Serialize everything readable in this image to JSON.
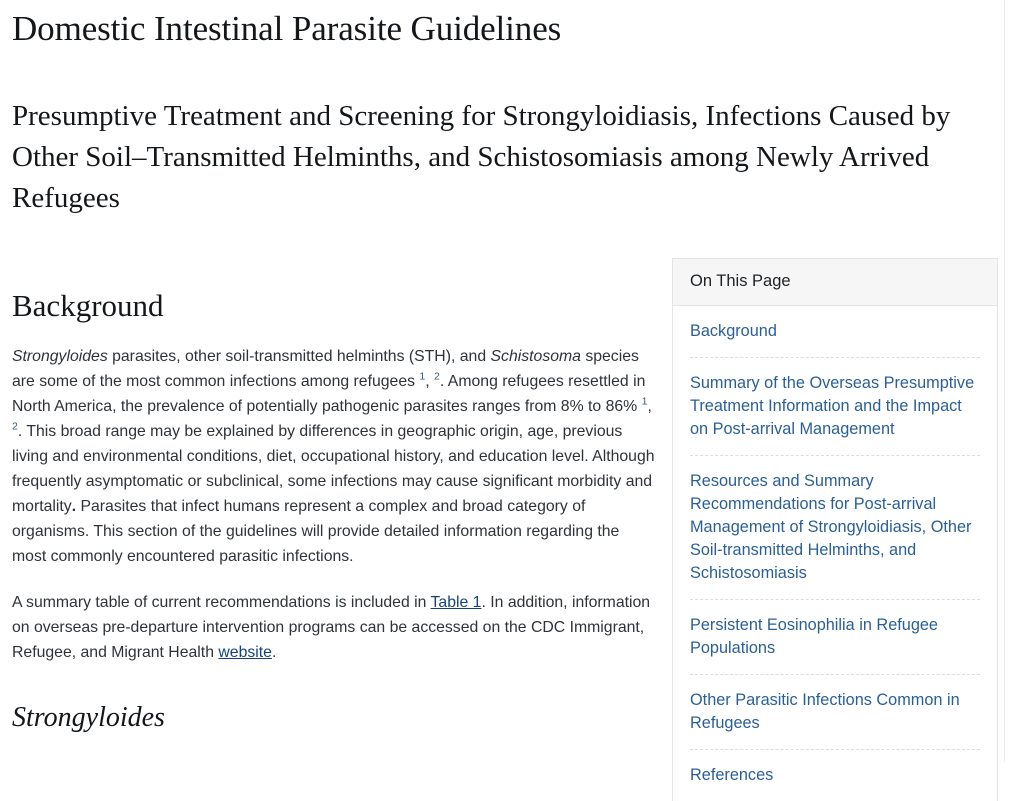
{
  "document": {
    "title": "Domestic Intestinal Parasite Guidelines",
    "subtitle": "Presumptive Treatment and Screening for Strongyloidiasis, Infections Caused by Other Soil–Transmitted Helminths, and Schistosomiasis among Newly Arrived Refugees"
  },
  "main": {
    "background_heading": "Background",
    "paragraph1": {
      "seg1_italic": "Strongyloides",
      "seg2": " parasites, other soil-transmitted helminths (STH), and ",
      "seg3_italic": "Schistosoma",
      "seg4": " species are some of the most common infections among refugees ",
      "ref1": "1",
      "seg5": ", ",
      "ref2": "2",
      "seg6": ". Among refugees resettled in North America, the prevalence of potentially pathogenic parasites ranges from 8% to 86% ",
      "ref3": "1",
      "seg7": ", ",
      "ref4": "2",
      "seg8": ". This broad range may be explained by differences in geographic origin, age, previous living and environmental conditions, diet, occupational history, and education level. Although frequently asymptomatic or subclinical, some infections may cause significant morbidity and mortality",
      "bold_period": ".",
      "seg9": " Parasites that infect humans represent a complex and broad category of organisms. This section of the guidelines will provide detailed information regarding the most commonly encountered parasitic infections."
    },
    "paragraph2": {
      "seg1": "A summary table of current recommendations is included in ",
      "link_table": "Table 1",
      "seg2": ".  In addition, information on overseas pre-departure intervention programs can be accessed on the CDC Immigrant, Refugee, and Migrant Health ",
      "link_website": "website",
      "seg3": "."
    },
    "strongyloides_heading": "Strongyloides"
  },
  "on_this_page": {
    "header": "On This Page",
    "items": [
      {
        "label": "Background"
      },
      {
        "label": "Summary of the Overseas Presumptive Treatment Information and the Impact on Post-arrival Management"
      },
      {
        "label": "Resources and Summary Recommendations for Post-arrival Management of Strongyloidiasis, Other Soil-transmitted Helminths, and Schistosomiasis"
      },
      {
        "label": "Persistent Eosinophilia in Refugee Populations"
      },
      {
        "label": "Other Parasitic Infections Common in Refugees"
      },
      {
        "label": "References"
      }
    ]
  },
  "colors": {
    "link_blue": "#2a5f96",
    "inline_link": "#14437a",
    "body_text": "#2e3338",
    "heading_text": "#14171a",
    "panel_header_bg": "#f6f6f6",
    "panel_border": "#e3e4e6",
    "dashed_separator": "#dcdddf"
  }
}
